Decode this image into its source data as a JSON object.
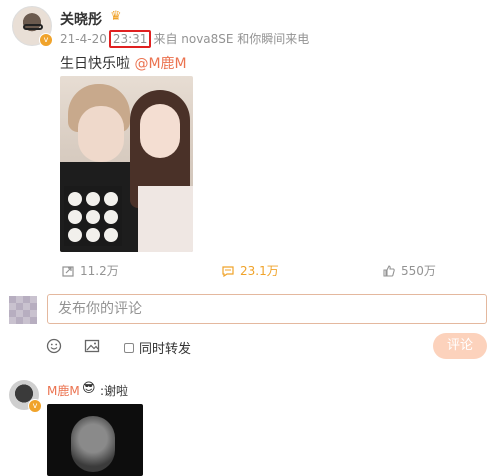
{
  "post": {
    "author": "关晓彤",
    "date": "21-4-20",
    "time": "23:31",
    "source": "来自 nova8SE 和你瞬间来电",
    "text_prefix": "生日快乐啦 ",
    "mention": "@M鹿M",
    "icons": {
      "verify": "verified-badge-icon",
      "crown": "crown-icon",
      "forward": "forward-icon",
      "comment": "comment-icon",
      "like": "like-icon"
    }
  },
  "actions": {
    "forward_count": "11.2万",
    "comment_count": "23.1万",
    "like_count": "550万"
  },
  "composer": {
    "placeholder": "发布你的评论",
    "forward_label": "同时转发",
    "submit_label": "评论",
    "icons": [
      "emoji-icon",
      "image-icon"
    ]
  },
  "reply": {
    "author": "M鹿M",
    "emoji": "😎",
    "text": ":谢啦"
  },
  "colors": {
    "accent": "#eb7350",
    "highlight": "#f0a32b",
    "time_box": "#e02020",
    "meta": "#939393",
    "submit_bg": "#fcd2bc"
  }
}
